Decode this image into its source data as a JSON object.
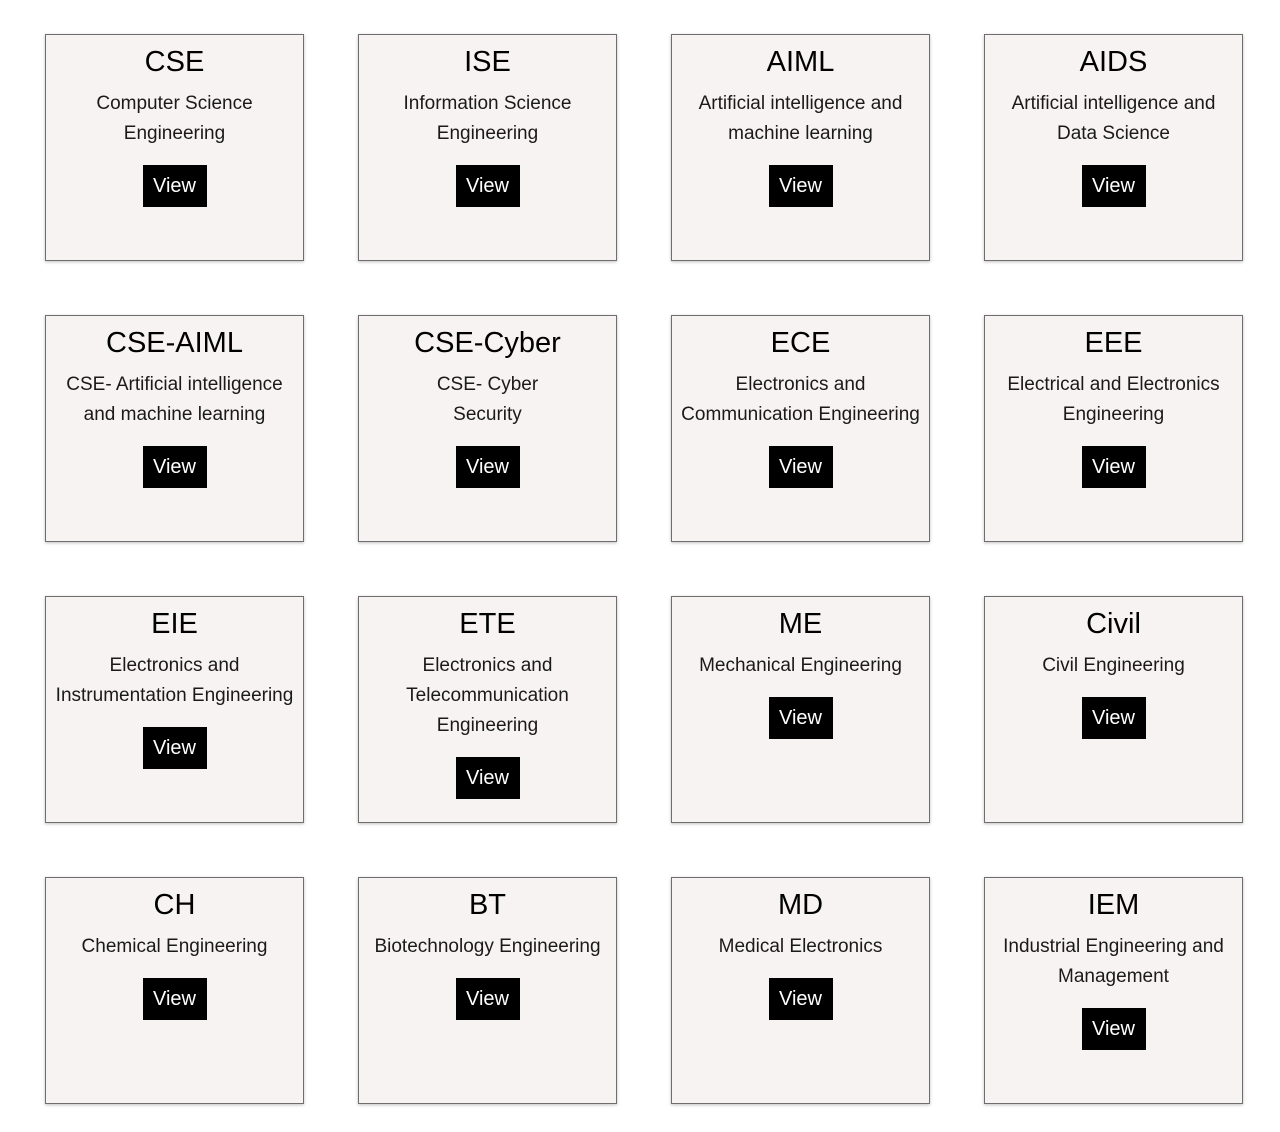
{
  "button_label": "View",
  "cards": [
    {
      "code": "CSE",
      "name": "Computer Science\nEngineering"
    },
    {
      "code": "ISE",
      "name": "Information Science\nEngineering"
    },
    {
      "code": "AIML",
      "name": "Artificial intelligence and\nmachine learning"
    },
    {
      "code": "AIDS",
      "name": "Artificial intelligence and\nData Science"
    },
    {
      "code": "CSE-AIML",
      "name": "CSE- Artificial intelligence\nand machine learning"
    },
    {
      "code": "CSE-Cyber",
      "name": "CSE- Cyber\nSecurity"
    },
    {
      "code": "ECE",
      "name": "Electronics and\nCommunication Engineering"
    },
    {
      "code": "EEE",
      "name": "Electrical and Electronics\nEngineering"
    },
    {
      "code": "EIE",
      "name": "Electronics and\nInstrumentation Engineering"
    },
    {
      "code": "ETE",
      "name": "Electronics and\nTelecommunication\nEngineering"
    },
    {
      "code": "ME",
      "name": "Mechanical Engineering"
    },
    {
      "code": "Civil",
      "name": "Civil Engineering"
    },
    {
      "code": "CH",
      "name": "Chemical Engineering"
    },
    {
      "code": "BT",
      "name": "Biotechnology Engineering"
    },
    {
      "code": "MD",
      "name": "Medical Electronics"
    },
    {
      "code": "IEM",
      "name": "Industrial Engineering and\nManagement"
    }
  ]
}
